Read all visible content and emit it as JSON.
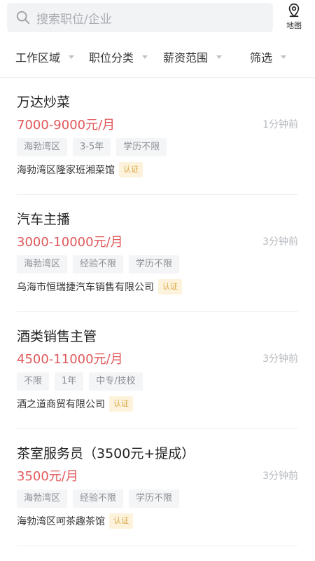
{
  "search": {
    "placeholder": "搜索职位/企业"
  },
  "map": {
    "label": "地图"
  },
  "filters": [
    {
      "label": "工作区域"
    },
    {
      "label": "职位分类"
    },
    {
      "label": "薪资范围"
    },
    {
      "label": "筛选"
    }
  ],
  "jobs": [
    {
      "title": "万达炒菜",
      "salary": "7000-9000元/月",
      "time": "1分钟前",
      "tags": [
        "海勃湾区",
        "3-5年",
        "学历不限"
      ],
      "company": "海勃湾区隆家班湘菜馆",
      "badge": "认证"
    },
    {
      "title": "汽车主播",
      "salary": "3000-10000元/月",
      "time": "3分钟前",
      "tags": [
        "海勃湾区",
        "经验不限",
        "学历不限"
      ],
      "company": "乌海市恒瑞捷汽车销售有限公司",
      "badge": "认证"
    },
    {
      "title": "酒类销售主管",
      "salary": "4500-11000元/月",
      "time": "3分钟前",
      "tags": [
        "不限",
        "1年",
        "中专/技校"
      ],
      "company": "酒之道商贸有限公司",
      "badge": "认证"
    },
    {
      "title": "茶室服务员（3500元+提成）",
      "salary": "3500元/月",
      "time": "3分钟前",
      "tags": [
        "海勃湾区",
        "经验不限",
        "学历不限"
      ],
      "company": "海勃湾区呵茶趣茶馆",
      "badge": "认证"
    }
  ],
  "colors": {
    "salary": "#e0585a",
    "badge_bg": "#fdf3dc",
    "badge_text": "#d9a640"
  }
}
